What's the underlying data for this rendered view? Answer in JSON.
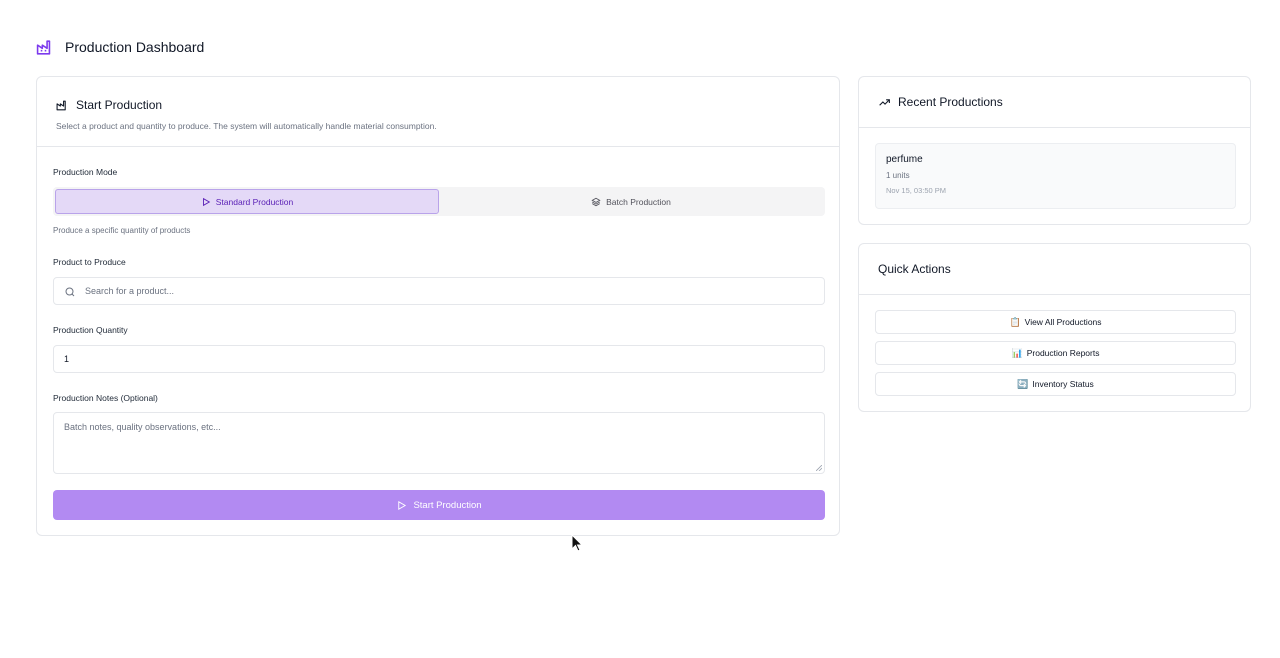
{
  "header": {
    "title": "Production Dashboard"
  },
  "start_production": {
    "title": "Start Production",
    "description": "Select a product and quantity to produce. The system will automatically handle material consumption.",
    "mode_label": "Production Mode",
    "modes": [
      {
        "label": "Standard Production",
        "active": true
      },
      {
        "label": "Batch Production",
        "active": false
      }
    ],
    "mode_hint": "Produce a specific quantity of products",
    "product_label": "Product to Produce",
    "product_placeholder": "Search for a product...",
    "quantity_label": "Production Quantity",
    "quantity_value": "1",
    "notes_label": "Production Notes (Optional)",
    "notes_placeholder": "Batch notes, quality observations, etc...",
    "submit_label": "Start Production"
  },
  "recent_productions": {
    "title": "Recent Productions",
    "items": [
      {
        "name": "perfume",
        "units": "1 units",
        "time": "Nov 15, 03:50 PM"
      }
    ]
  },
  "quick_actions": {
    "title": "Quick Actions",
    "buttons": [
      {
        "emoji": "📋",
        "label": "View All Productions"
      },
      {
        "emoji": "📊",
        "label": "Production Reports"
      },
      {
        "emoji": "🔄",
        "label": "Inventory Status"
      }
    ]
  },
  "colors": {
    "accent": "#7c3aed",
    "submit_bg": "#b28af2",
    "active_mode_bg": "#e4d9f7"
  }
}
